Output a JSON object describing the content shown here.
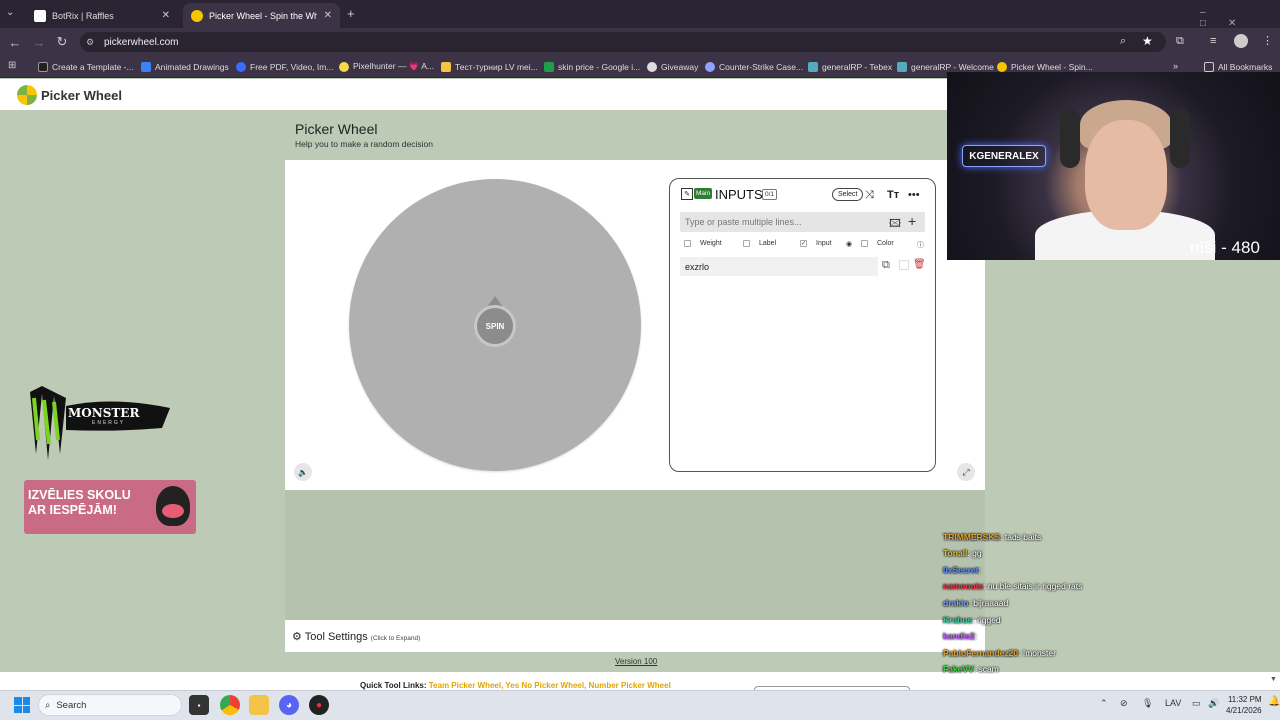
{
  "browser": {
    "tabs": [
      {
        "title": "BotRix | Raffles",
        "active": false
      },
      {
        "title": "Picker Wheel - Spin the Wheel t",
        "active": true
      }
    ],
    "url": "pickerwheel.com",
    "bookmarks": [
      "Create a Template -...",
      "Animated Drawings",
      "Free PDF, Video, Im...",
      "Pixelhunter — 💗 A...",
      "Тест-турнир LV mei...",
      "skin price - Google i...",
      "Giveaway",
      "Counter-Strike Case...",
      "generalRP - Tebex",
      "generalRP - Welcome",
      "Picker Wheel - Spin..."
    ],
    "all_bookmarks": "All Bookmarks"
  },
  "site": {
    "logo": "Picker Wheel",
    "title": "Picker Wheel",
    "subtitle": "Help you to make a random decision",
    "spin": "SPIN",
    "inputs": {
      "badge": "Main",
      "title": "INPUTS",
      "count": "0/1",
      "select": "Select",
      "placeholder": "Type or paste multiple lines...",
      "options": [
        "Weight",
        "Label",
        "Input",
        "Color"
      ],
      "entries": [
        "exzrlo"
      ]
    },
    "tool_settings": "Tool Settings",
    "tool_settings_hint": "(Click to Expand)",
    "version": "Version 100",
    "quick_links_label": "Quick Tool Links:",
    "quick_links": "Team Picker Wheel, Yes No Picker Wheel, Number Picker Wheel"
  },
  "ads": {
    "monster": "MONSTER",
    "monster_sub": "ENERGY",
    "banner": "IZVĒLIES SKOLU AR IESPĒJĀM!"
  },
  "stream": {
    "cam_logo": "KGENERALEX",
    "overlay": "nīši - 480",
    "chat": [
      {
        "user": "TRIMMERSKS",
        "msg": ": tads baits",
        "color": "#e0a030"
      },
      {
        "user": "Tonall",
        "msg": ": gg",
        "color": "#e0c030"
      },
      {
        "user": "0xSecret",
        "msg": ":",
        "color": "#6090ff"
      },
      {
        "user": "nameouts",
        "msg": ": nu ble sitais ir rigged rats",
        "color": "#ff3040"
      },
      {
        "user": "drakio",
        "msg": ": bijraaaad",
        "color": "#7aa0ff"
      },
      {
        "user": "Krabus",
        "msg": ": rigged",
        "color": "#40d0a0"
      },
      {
        "user": "kandis2",
        "msg": ":",
        "color": "#c060ff"
      },
      {
        "user": "PabloFernandez20",
        "msg": ": !monster",
        "color": "#e0a030"
      },
      {
        "user": "FakeVV",
        "msg": ": scam",
        "color": "#40e040"
      }
    ]
  },
  "taskbar": {
    "search": "Search",
    "lang": "LAV",
    "time": "11:32 PM",
    "date": "4/21/2026"
  }
}
